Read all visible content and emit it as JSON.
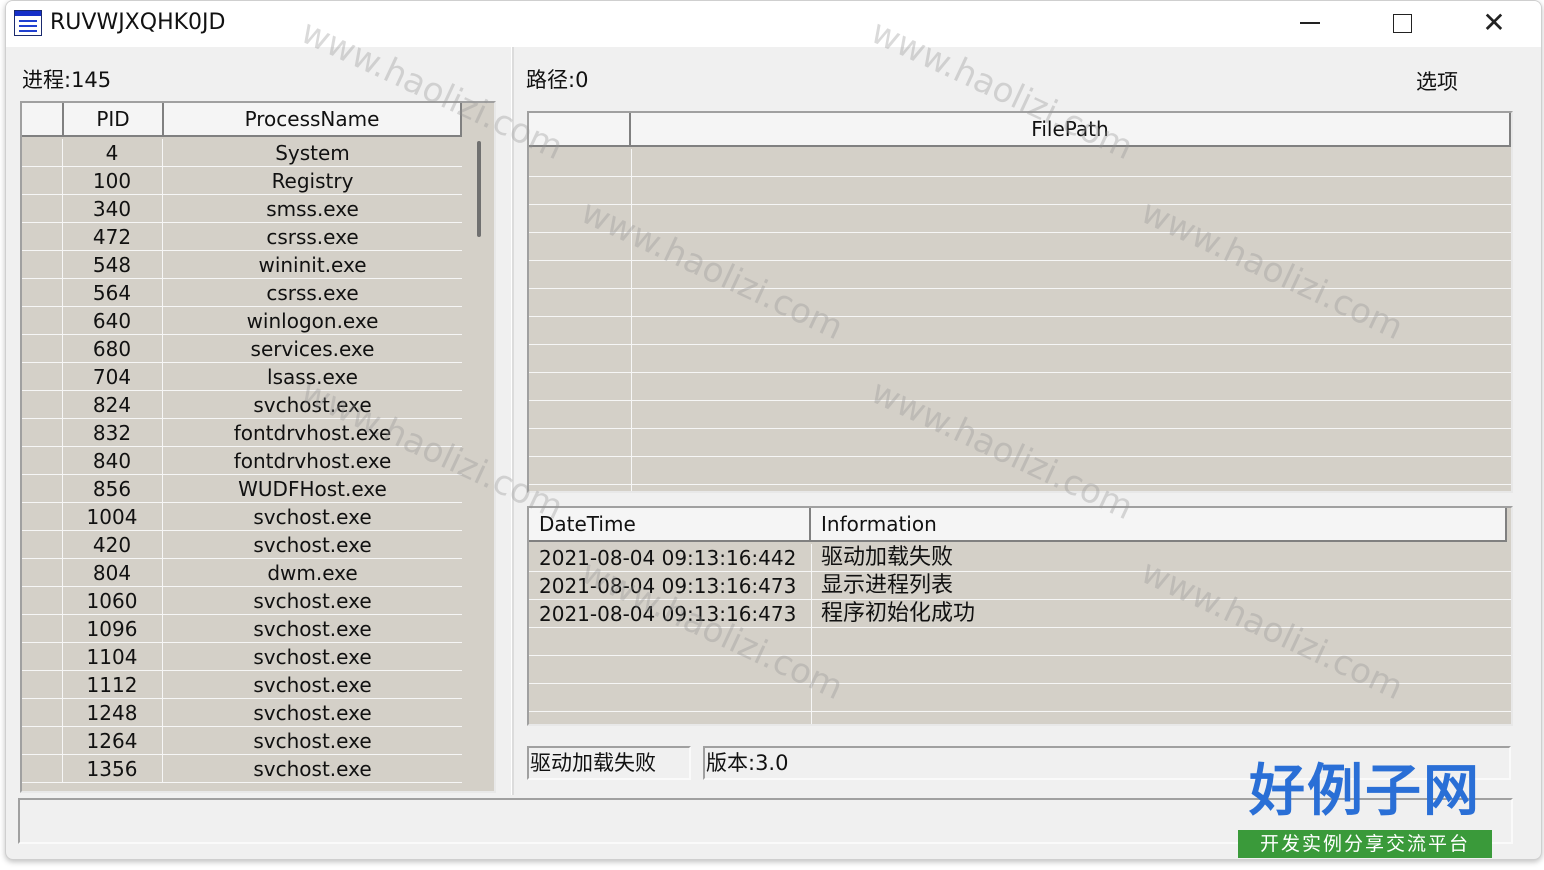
{
  "window": {
    "title": "RUVWJXQHK0JD"
  },
  "left": {
    "process_label": "进程:145",
    "columns": [
      "PID",
      "ProcessName"
    ],
    "rows": [
      {
        "pid": "4",
        "name": "System"
      },
      {
        "pid": "100",
        "name": "Registry"
      },
      {
        "pid": "340",
        "name": "smss.exe"
      },
      {
        "pid": "472",
        "name": "csrss.exe"
      },
      {
        "pid": "548",
        "name": "wininit.exe"
      },
      {
        "pid": "564",
        "name": "csrss.exe"
      },
      {
        "pid": "640",
        "name": "winlogon.exe"
      },
      {
        "pid": "680",
        "name": "services.exe"
      },
      {
        "pid": "704",
        "name": "lsass.exe"
      },
      {
        "pid": "824",
        "name": "svchost.exe"
      },
      {
        "pid": "832",
        "name": "fontdrvhost.exe"
      },
      {
        "pid": "840",
        "name": "fontdrvhost.exe"
      },
      {
        "pid": "856",
        "name": "WUDFHost.exe"
      },
      {
        "pid": "1004",
        "name": "svchost.exe"
      },
      {
        "pid": "420",
        "name": "svchost.exe"
      },
      {
        "pid": "804",
        "name": "dwm.exe"
      },
      {
        "pid": "1060",
        "name": "svchost.exe"
      },
      {
        "pid": "1096",
        "name": "svchost.exe"
      },
      {
        "pid": "1104",
        "name": "svchost.exe"
      },
      {
        "pid": "1112",
        "name": "svchost.exe"
      },
      {
        "pid": "1248",
        "name": "svchost.exe"
      },
      {
        "pid": "1264",
        "name": "svchost.exe"
      },
      {
        "pid": "1356",
        "name": "svchost.exe"
      }
    ]
  },
  "right": {
    "path_label": "路径:0",
    "options_label": "选项",
    "filepath_column": "FilePath",
    "log": {
      "columns": [
        "DateTime",
        "Information"
      ],
      "rows": [
        {
          "time": "2021-08-04 09:13:16:442",
          "info": "驱动加载失败"
        },
        {
          "time": "2021-08-04 09:13:16:473",
          "info": "显示进程列表"
        },
        {
          "time": "2021-08-04 09:13:16:473",
          "info": "程序初始化成功"
        }
      ]
    },
    "driver_status": "驱动加载失败",
    "version": "版本:3.0"
  },
  "watermark": {
    "url": "www.haolizi.com",
    "logo_main": "好例子网",
    "logo_sub": "开发实例分享交流平台"
  }
}
